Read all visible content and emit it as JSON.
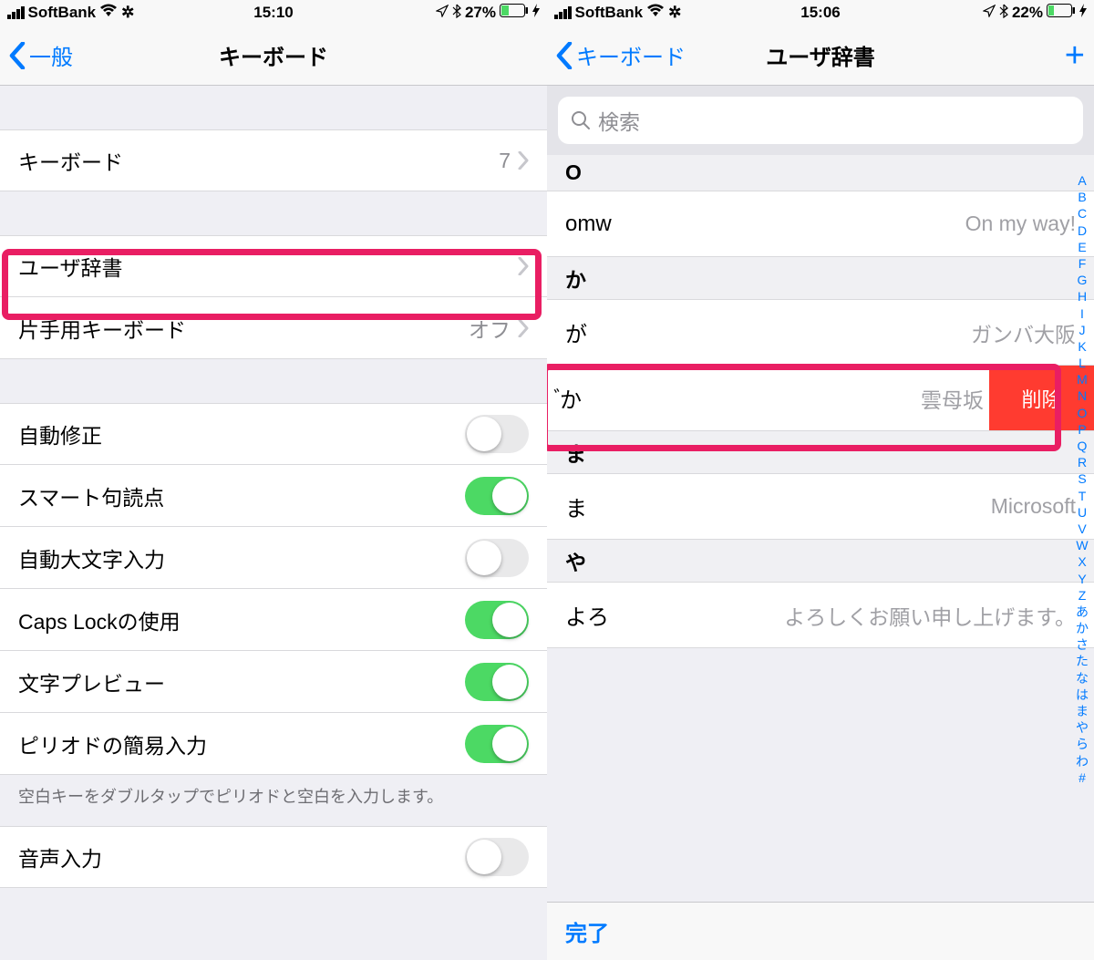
{
  "left": {
    "status": {
      "carrier": "SoftBank",
      "time": "15:10",
      "battery": "27%"
    },
    "nav": {
      "back": "一般",
      "title": "キーボード"
    },
    "rows": {
      "keyboard": {
        "label": "キーボード",
        "detail": "7"
      },
      "user_dict": {
        "label": "ユーザ辞書"
      },
      "one_hand": {
        "label": "片手用キーボード",
        "detail": "オフ"
      },
      "auto_correct": {
        "label": "自動修正"
      },
      "smart_punct": {
        "label": "スマート句読点"
      },
      "auto_caps": {
        "label": "自動大文字入力"
      },
      "caps_lock": {
        "label": "Caps Lockの使用"
      },
      "char_preview": {
        "label": "文字プレビュー"
      },
      "period_shortcut": {
        "label": "ピリオドの簡易入力"
      },
      "voice_input": {
        "label": "音声入力"
      }
    },
    "footer": "空白キーをダブルタップでピリオドと空白を入力します。"
  },
  "right": {
    "status": {
      "carrier": "SoftBank",
      "time": "15:06",
      "battery": "22%"
    },
    "nav": {
      "back": "キーボード",
      "title": "ユーザ辞書"
    },
    "search_placeholder": "検索",
    "sections": {
      "o": {
        "header": "O",
        "items": [
          {
            "shortcut": "omw",
            "phrase": "On my way!"
          }
        ]
      },
      "ka": {
        "header": "か",
        "items": [
          {
            "shortcut": "が",
            "phrase": "ガンバ大阪"
          },
          {
            "shortcut": "゙か",
            "phrase": "雲母坂",
            "swiped": true,
            "delete": "削除"
          }
        ]
      },
      "ma": {
        "header": "ま",
        "items": [
          {
            "shortcut": "ま",
            "phrase": "Microsoft"
          }
        ]
      },
      "ya": {
        "header": "や",
        "items": [
          {
            "shortcut": "よろ",
            "phrase": "よろしくお願い申し上げます。"
          }
        ]
      }
    },
    "index": [
      "A",
      "B",
      "C",
      "D",
      "E",
      "F",
      "G",
      "H",
      "I",
      "J",
      "K",
      "L",
      "M",
      "N",
      "O",
      "P",
      "Q",
      "R",
      "S",
      "T",
      "U",
      "V",
      "W",
      "X",
      "Y",
      "Z",
      "あ",
      "か",
      "さ",
      "た",
      "な",
      "は",
      "ま",
      "や",
      "ら",
      "わ",
      "#"
    ],
    "done": "完了"
  }
}
